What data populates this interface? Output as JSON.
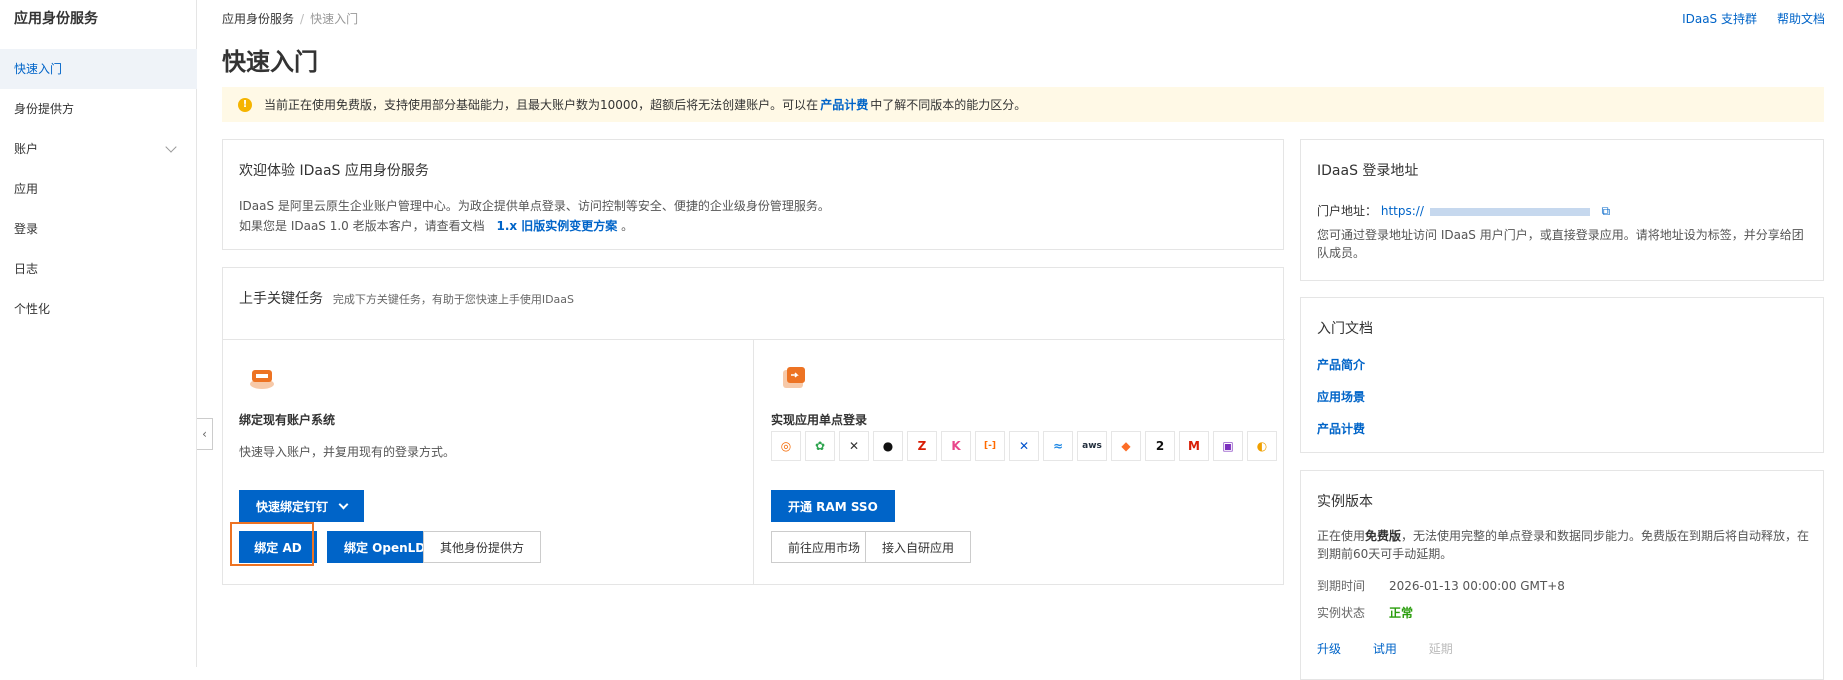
{
  "sidebar": {
    "title": "应用身份服务",
    "items": [
      {
        "label": "快速入门"
      },
      {
        "label": "身份提供方"
      },
      {
        "label": "账户"
      },
      {
        "label": "应用"
      },
      {
        "label": "登录"
      },
      {
        "label": "日志"
      },
      {
        "label": "个性化"
      }
    ]
  },
  "header": {
    "breadcrumb": [
      "应用身份服务",
      "快速入门"
    ],
    "links": [
      "IDaaS 支持群",
      "帮助文档"
    ],
    "title": "快速入门"
  },
  "notice": {
    "text_before": "当前正在使用免费版，支持使用部分基础能力，且最大账户数为10000，超额后将无法创建账户。可以在",
    "link": "产品计费",
    "text_after": "中了解不同版本的能力区分。"
  },
  "welcome": {
    "title": "欢迎体验 IDaaS 应用身份服务",
    "line1": "IDaaS 是阿里云原生企业账户管理中心。为政企提供单点登录、访问控制等安全、便捷的企业级身份管理服务。",
    "line2_before": "如果您是 IDaaS 1.0 老版本客户，请查看文档",
    "line2_link": "1.x 旧版实例变更方案",
    "line2_after": "。"
  },
  "tasks": {
    "title": "上手关键任务",
    "subtitle": "完成下方关键任务，有助于您快速上手使用IDaaS",
    "left": {
      "heading": "绑定现有账户系统",
      "desc": "快速导入账户，并复用现有的登录方式。",
      "dropdown_btn": "快速绑定钉钉",
      "btn_ad": "绑定 AD",
      "btn_ldap": "绑定 OpenLDAP",
      "btn_other": "其他身份提供方"
    },
    "right": {
      "heading": "实现应用单点登录",
      "btn_ram": "开通 RAM SSO",
      "btn_market": "前往应用市场",
      "btn_custom": "接入自研应用",
      "app_icons": [
        {
          "name": "grafana-icon",
          "glyph": "◎",
          "color": "#f46800"
        },
        {
          "name": "confluence-flower-icon",
          "glyph": "✿",
          "color": "#2ea44f"
        },
        {
          "name": "jenkins-icon",
          "glyph": "✕",
          "color": "#333333"
        },
        {
          "name": "github-icon",
          "glyph": "●",
          "color": "#111111"
        },
        {
          "name": "zentao-icon",
          "glyph": "Z",
          "color": "#d81e06"
        },
        {
          "name": "kibana-icon",
          "glyph": "K",
          "color": "#e8478b"
        },
        {
          "name": "aliyun-icon",
          "glyph": "[-]",
          "color": "#ff6a00"
        },
        {
          "name": "jira-icon",
          "glyph": "✕",
          "color": "#0052cc"
        },
        {
          "name": "wave-icon",
          "glyph": "≈",
          "color": "#1e88e5"
        },
        {
          "name": "aws-icon",
          "glyph": "aws",
          "color": "#232f3e"
        },
        {
          "name": "gitlab-icon",
          "glyph": "◆",
          "color": "#fc6d26"
        },
        {
          "name": "app-2-icon",
          "glyph": "2",
          "color": "#111111"
        },
        {
          "name": "m-icon",
          "glyph": "M",
          "color": "#d81e06"
        },
        {
          "name": "app-purple-icon",
          "glyph": "▣",
          "color": "#7b2fbe"
        },
        {
          "name": "app-partial-icon",
          "glyph": "◐",
          "color": "#f0a000"
        }
      ]
    }
  },
  "login_card": {
    "title": "IDaaS 登录地址",
    "portal_label": "门户地址：",
    "portal_value": "https://",
    "desc": "您可通过登录地址访问 IDaaS 用户门户，或直接登录应用。请将地址设为标签，并分享给团队成员。"
  },
  "docs_card": {
    "title": "入门文档",
    "links": [
      "产品简介",
      "应用场景",
      "产品计费"
    ]
  },
  "instance_card": {
    "title": "实例版本",
    "desc_before": "正在使用",
    "desc_bold": "免费版",
    "desc_after": "，无法使用完整的单点登录和数据同步能力。免费版在到期后将自动释放，在到期前60天可手动延期。",
    "expire_label": "到期时间",
    "expire_value": "2026-01-13 00:00:00 GMT+8",
    "status_label": "实例状态",
    "status_value": "正常",
    "actions": [
      "升级",
      "试用",
      "延期"
    ]
  },
  "colors": {
    "primary": "#0064c8",
    "highlight": "#ed7323",
    "success": "#2a9d0c"
  }
}
